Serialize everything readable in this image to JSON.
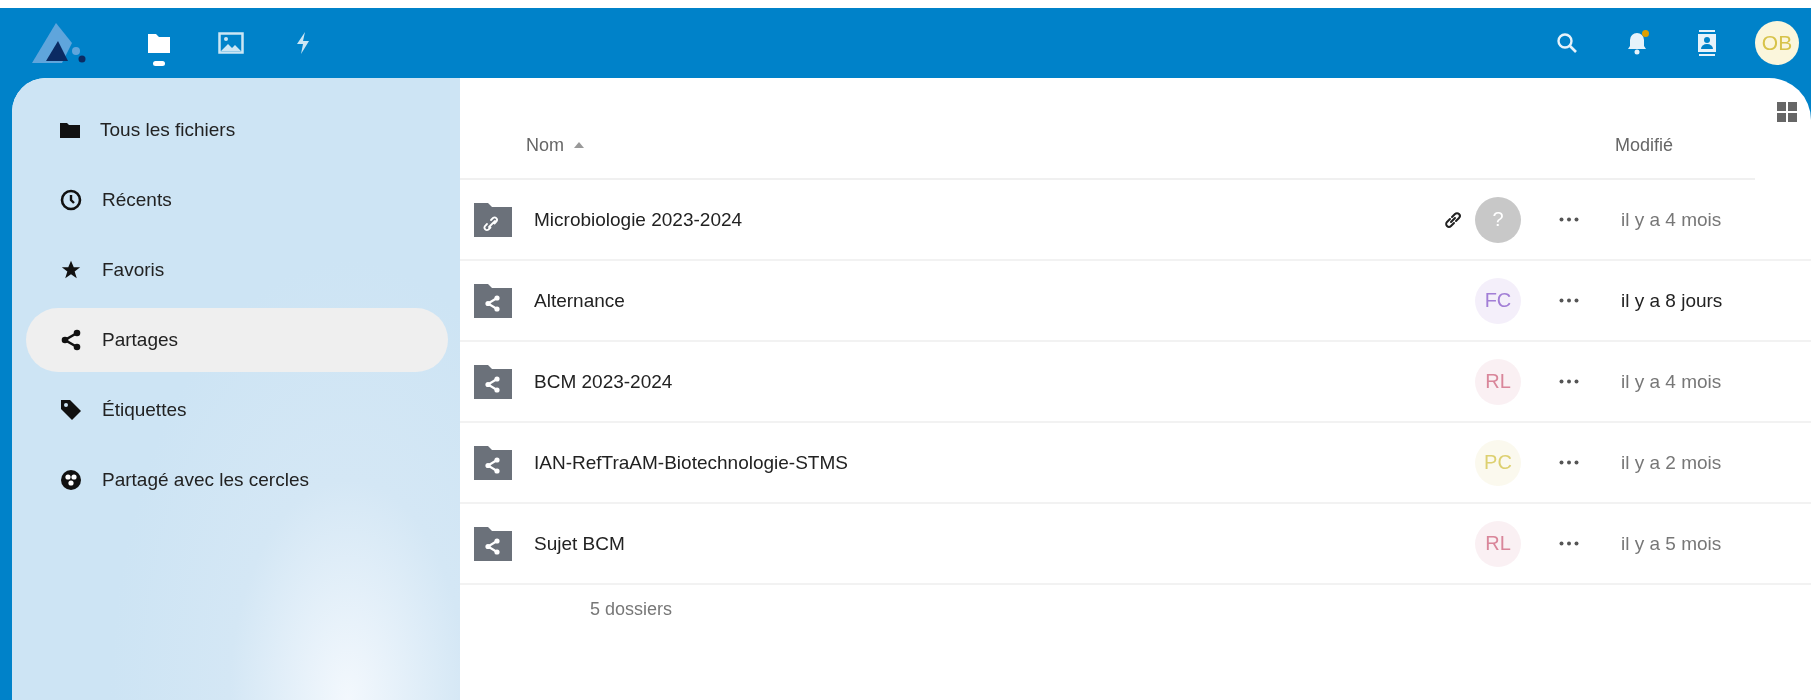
{
  "header": {
    "apps": [
      {
        "kind": "files",
        "selected": true
      },
      {
        "kind": "photos",
        "selected": false
      },
      {
        "kind": "activity",
        "selected": false
      }
    ],
    "notification": true,
    "avatar": "OB"
  },
  "sidebar": {
    "items": [
      {
        "kind": "folder",
        "label": "Tous les fichiers",
        "selected": false
      },
      {
        "kind": "clock",
        "label": "Récents",
        "selected": false
      },
      {
        "kind": "star",
        "label": "Favoris",
        "selected": false
      },
      {
        "kind": "share",
        "label": "Partages",
        "selected": true
      },
      {
        "kind": "tag",
        "label": "Étiquettes",
        "selected": false
      },
      {
        "kind": "circles",
        "label": "Partagé avec les cercles",
        "selected": false
      }
    ]
  },
  "table": {
    "columns": [
      "Nom",
      "Modifié"
    ],
    "rows": [
      {
        "kind": "link",
        "name": "Microbiologie 2023-2024",
        "link_shared": true,
        "avatar": "?",
        "color": "#c8c8c8",
        "modified": "il y a 4 mois",
        "recent": false
      },
      {
        "kind": "shared",
        "name": "Alternance",
        "link_shared": false,
        "avatar": "FC",
        "color": "#a27ed6",
        "modified": "il y a 8 jours",
        "recent": true
      },
      {
        "kind": "shared",
        "name": "BCM 2023-2024",
        "link_shared": false,
        "avatar": "RL",
        "color": "#d9869a",
        "modified": "il y a 4 mois",
        "recent": false
      },
      {
        "kind": "shared",
        "name": "IAN-RefTraAM-Biotechnologie-STMS",
        "link_shared": false,
        "avatar": "PC",
        "color": "#ddd070",
        "modified": "il y a 2 mois",
        "recent": false
      },
      {
        "kind": "shared",
        "name": "Sujet BCM",
        "link_shared": false,
        "avatar": "RL",
        "color": "#d9869a",
        "modified": "il y a 5 mois",
        "recent": false
      }
    ],
    "summary": "5 dossiers"
  }
}
